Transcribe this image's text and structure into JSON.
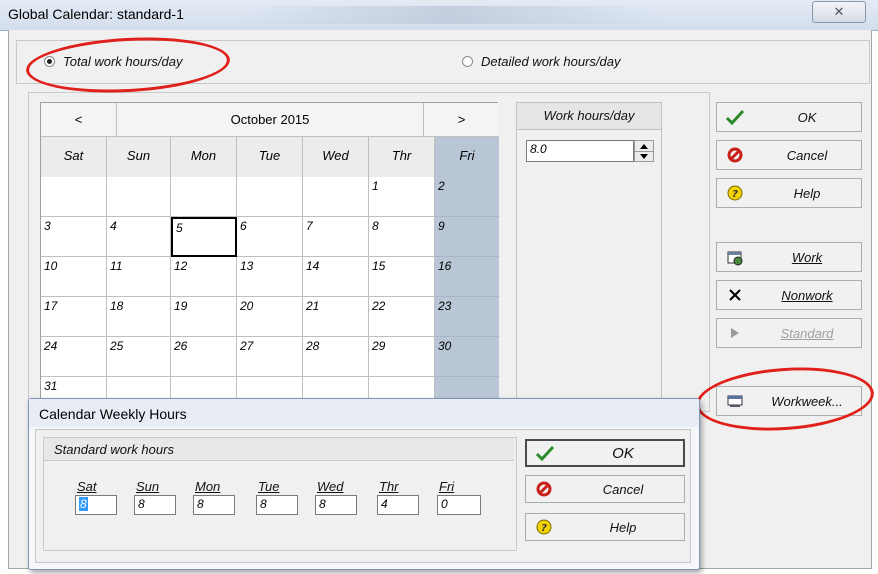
{
  "window": {
    "title": "Global Calendar: standard-1",
    "close_label": "✕"
  },
  "mode": {
    "total_label": "Total work hours/day",
    "total_selected": true,
    "detailed_label": "Detailed work hours/day",
    "detailed_selected": false
  },
  "calendar": {
    "prev_label": "<",
    "next_label": ">",
    "month_label": "October 2015",
    "days": [
      "Sat",
      "Sun",
      "Mon",
      "Tue",
      "Wed",
      "Thr",
      "Fri"
    ],
    "rows": [
      [
        "",
        "",
        "",
        "",
        "",
        "1",
        "2"
      ],
      [
        "3",
        "4",
        "5",
        "6",
        "7",
        "8",
        "9"
      ],
      [
        "10",
        "11",
        "12",
        "13",
        "14",
        "15",
        "16"
      ],
      [
        "17",
        "18",
        "19",
        "20",
        "21",
        "22",
        "23"
      ],
      [
        "24",
        "25",
        "26",
        "27",
        "28",
        "29",
        "30"
      ],
      [
        "31",
        "",
        "",
        "",
        "",
        "",
        ""
      ]
    ],
    "selected_day": "5"
  },
  "work_hours": {
    "label": "Work hours/day",
    "value": "8.0"
  },
  "buttons": {
    "ok": "OK",
    "cancel": "Cancel",
    "help": "Help",
    "work": "Work",
    "nonwork": "Nonwork",
    "standard": "Standard",
    "workweek": "Workweek..."
  },
  "weekly_dialog": {
    "title": "Calendar Weekly Hours",
    "group_label": "Standard work hours",
    "days": [
      {
        "label": "Sat",
        "value": "8"
      },
      {
        "label": "Sun",
        "value": "8"
      },
      {
        "label": "Mon",
        "value": "8"
      },
      {
        "label": "Tue",
        "value": "8"
      },
      {
        "label": "Wed",
        "value": "8"
      },
      {
        "label": "Thr",
        "value": "4"
      },
      {
        "label": "Fri",
        "value": "0"
      }
    ],
    "ok": "OK",
    "cancel": "Cancel",
    "help": "Help"
  },
  "colors": {
    "friday": "#b9c6d6",
    "annotation": "#e0201a",
    "ok_check": "#2a8a2a",
    "cancel_icon": "#c8201a",
    "help_icon": "#f2d200"
  }
}
